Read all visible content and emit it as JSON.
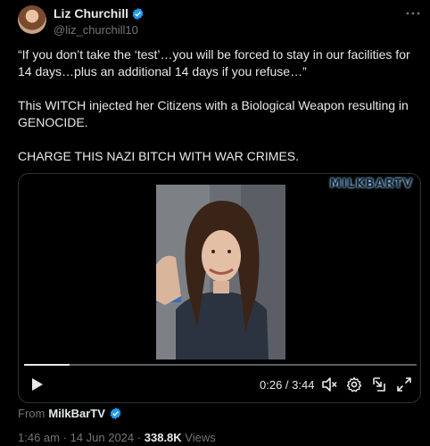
{
  "author": {
    "name": "Liz Churchill",
    "handle": "@liz_churchill10",
    "verified": true
  },
  "tweet": {
    "paragraphs": [
      "“If you don’t take the ‘test’…you will be forced to stay in our facilities for 14 days…plus an additional 14 days if you refuse…”",
      "This WITCH injected her Citizens with a Biological Weapon resulting in GENOCIDE.",
      "CHARGE THIS NAZI BITCH WITH WAR CRIMES."
    ]
  },
  "video": {
    "watermark": "MILKBARTV",
    "time_display": "0:26 / 3:44",
    "progress_fraction": 0.116
  },
  "source": {
    "prefix": "From",
    "name": "MilkBarTV"
  },
  "meta": {
    "time": "1:46 am",
    "separator": "·",
    "date": "14 Jun 2024",
    "views_count": "338.8K",
    "views_label": "Views"
  },
  "colors": {
    "background": "#000000",
    "text": "#e7e9ea",
    "muted": "#71767b",
    "verified": "#1d9bf0"
  }
}
